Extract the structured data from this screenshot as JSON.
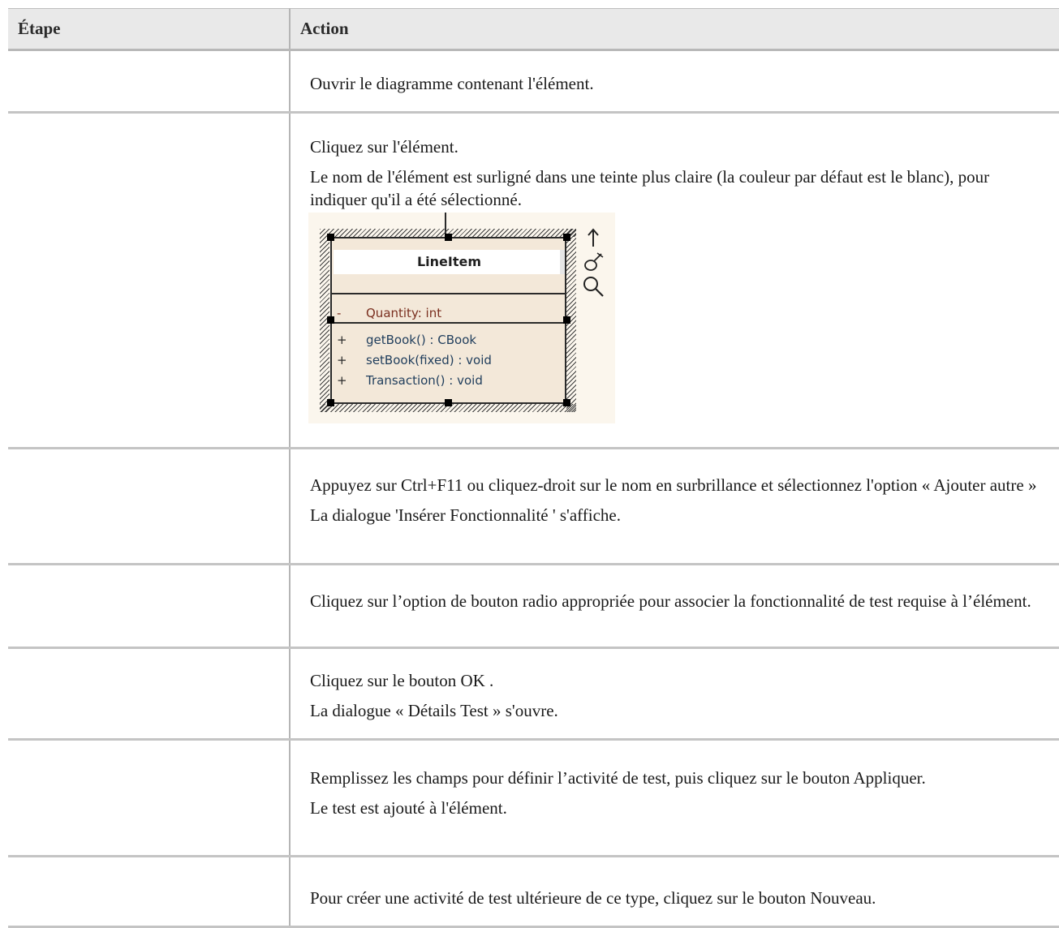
{
  "table": {
    "headers": {
      "step": "Étape",
      "action": "Action"
    },
    "rows": [
      {
        "step": "",
        "lines": [
          "Ouvrir le diagramme contenant l'élément."
        ]
      },
      {
        "step": "",
        "lines": [
          "Cliquez sur l'élément.",
          "Le nom de l'élément est surligné dans une teinte plus claire (la couleur par défaut est le blanc), pour indiquer qu'il a été sélectionné."
        ]
      },
      {
        "step": "",
        "lines": [
          "Appuyez sur Ctrl+F11 ou cliquez-droit sur le nom en surbrillance et sélectionnez l'option « Ajouter autre »",
          "La dialogue 'Insérer Fonctionnalité ' s'affiche."
        ]
      },
      {
        "step": "",
        "lines": [
          "Cliquez sur l’option de bouton radio appropriée pour associer la fonctionnalité de test requise à l’élément."
        ]
      },
      {
        "step": "",
        "lines": [
          "Cliquez sur le bouton OK .",
          "La dialogue « Détails Test » s'ouvre."
        ]
      },
      {
        "step": "",
        "lines": [
          "Remplissez les champs pour définir l’activité de test, puis cliquez sur le bouton Appliquer.",
          "Le test est ajouté à l'élément."
        ]
      },
      {
        "step": "",
        "lines": [
          "Pour créer une activité de test ultérieure de ce type, cliquez sur le bouton Nouveau."
        ]
      }
    ]
  },
  "uml_class": {
    "name": "LineItem",
    "attribute": {
      "visibility": "-",
      "text": "Quantity:  int"
    },
    "operations": [
      {
        "visibility": "+",
        "text": "getBook() : CBook"
      },
      {
        "visibility": "+",
        "text": "setBook(fixed) : void"
      },
      {
        "visibility": "+",
        "text": "Transaction() : void"
      }
    ],
    "side_icons": [
      "arrow-up-icon",
      "paint-brush-icon",
      "magnifier-icon"
    ]
  },
  "colors": {
    "header_bg": "#e9e9e9",
    "figure_bg": "#fbf6ed",
    "class_fill": "#f3e8d9",
    "attribute_text": "#7a2f1f",
    "operation_text": "#1f3d5c"
  }
}
